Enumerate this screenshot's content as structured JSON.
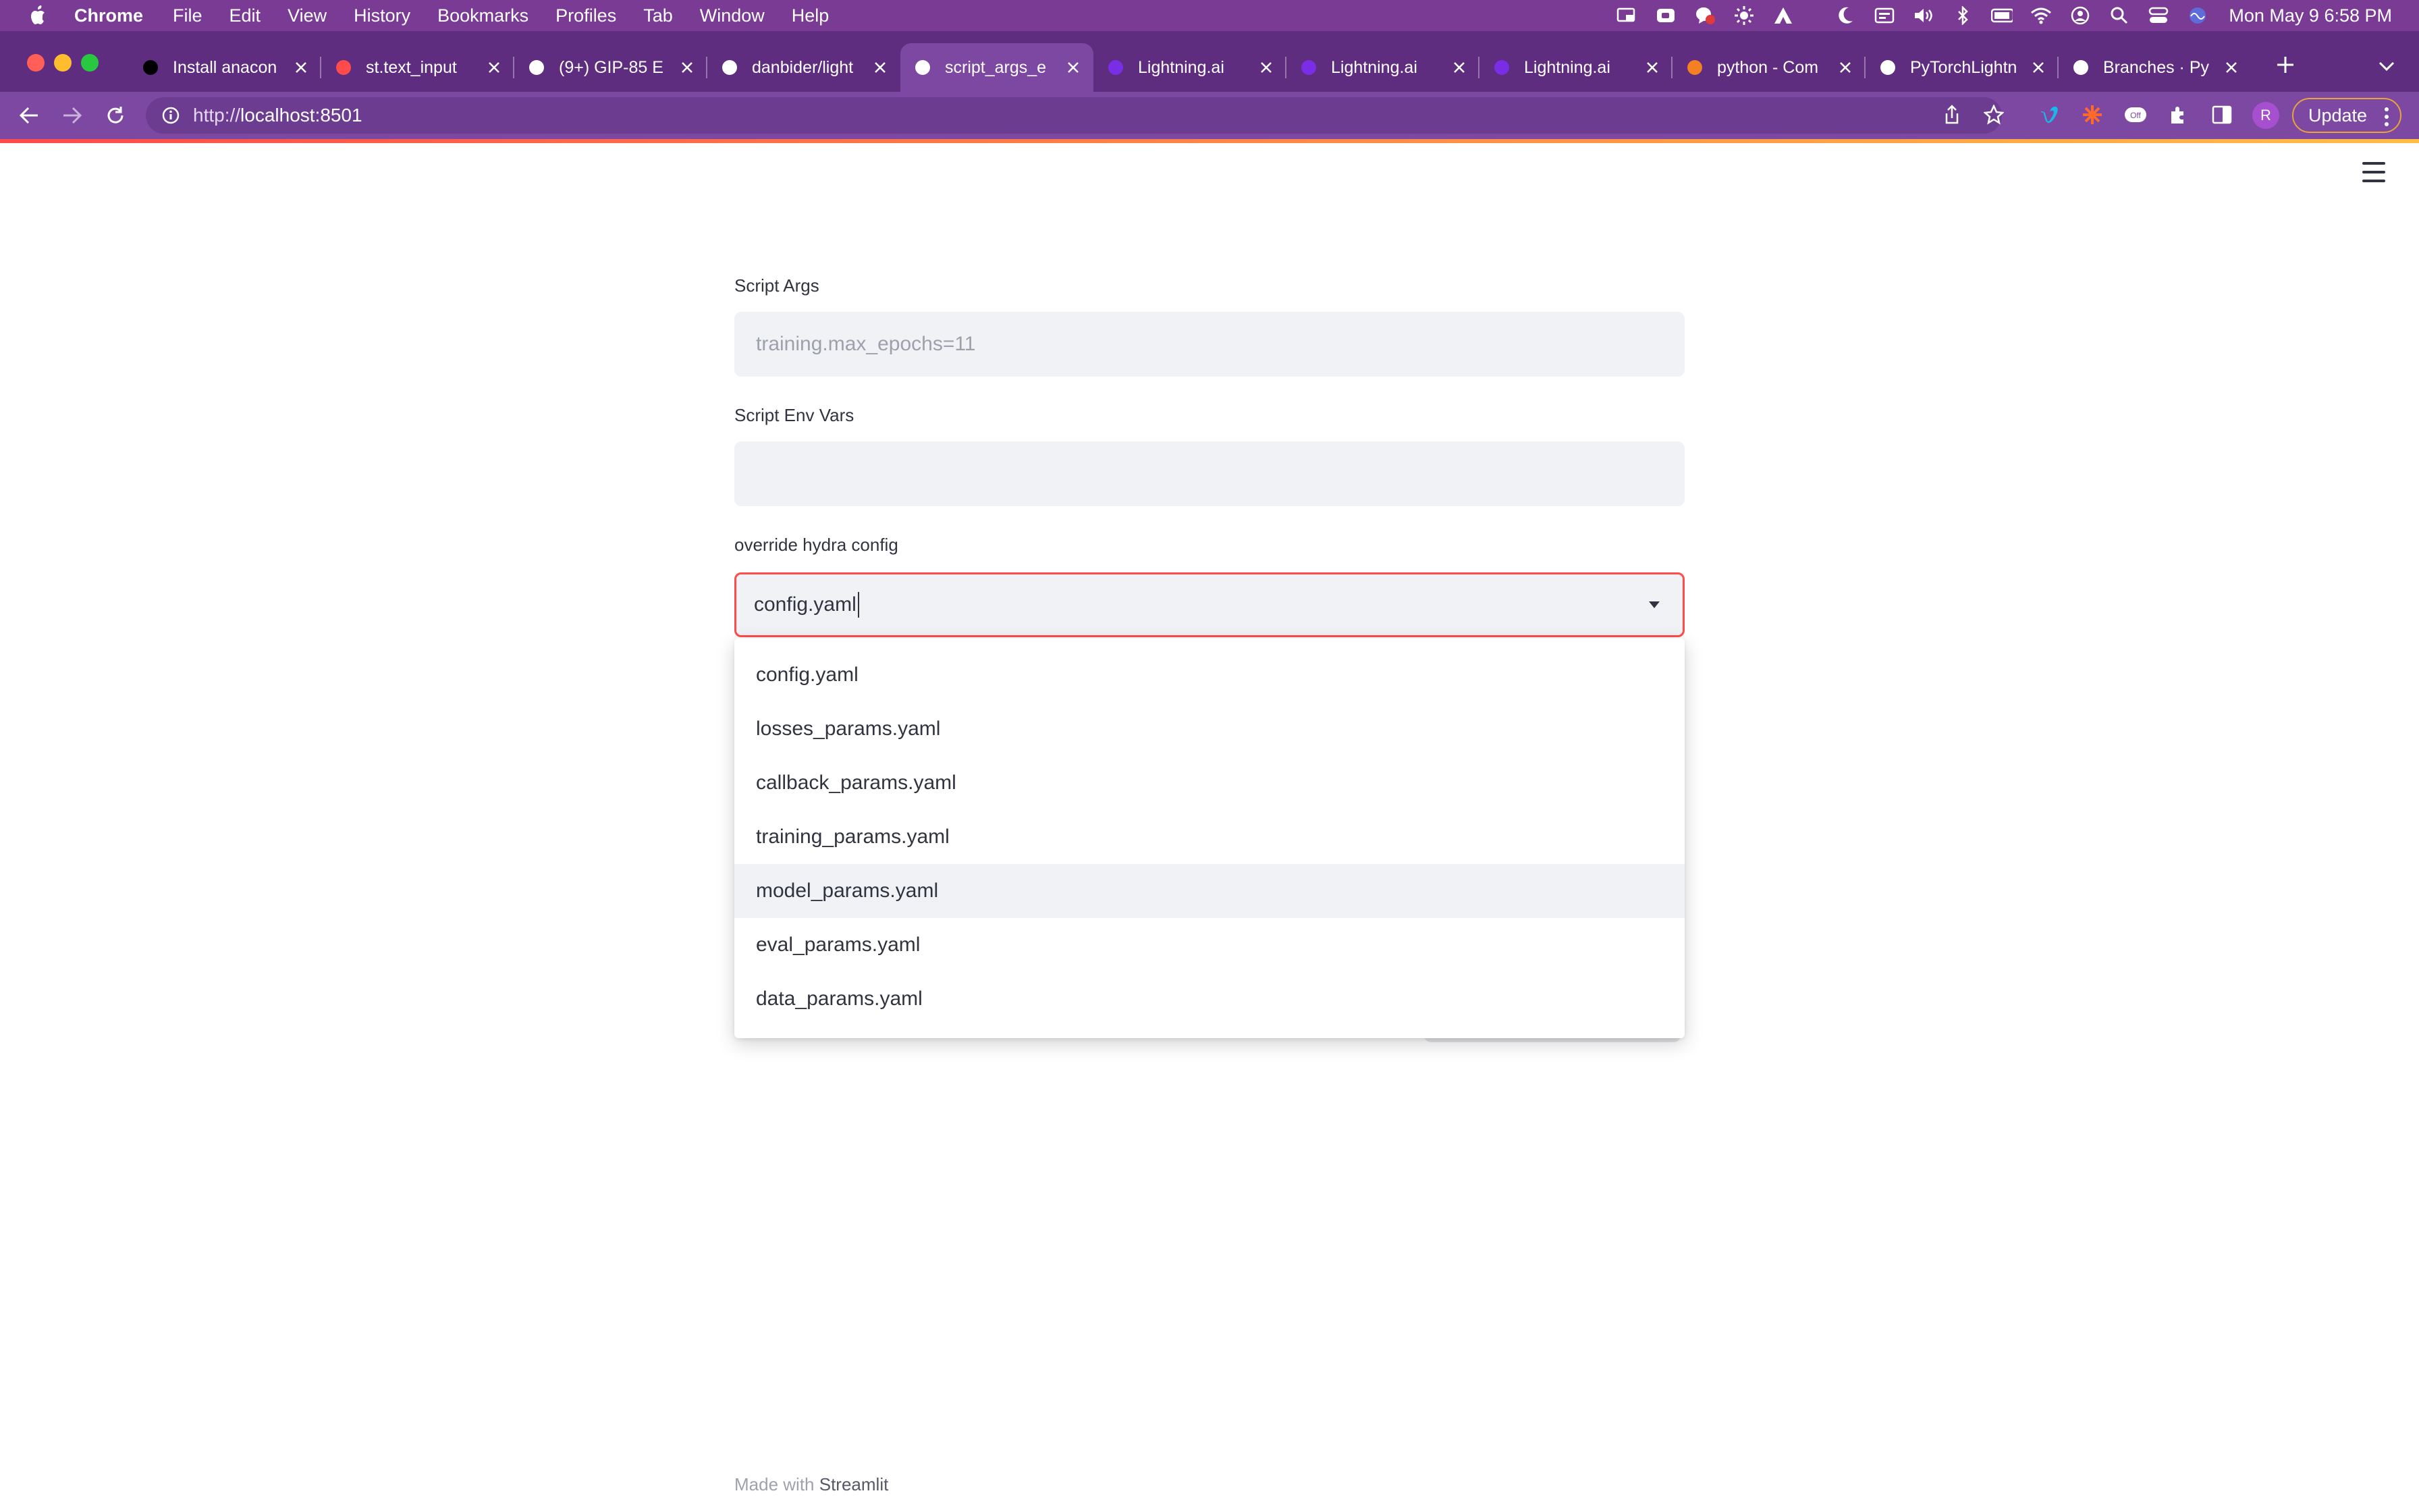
{
  "menubar": {
    "app_name": "Chrome",
    "menus": [
      "File",
      "Edit",
      "View",
      "History",
      "Bookmarks",
      "Profiles",
      "Tab",
      "Window",
      "Help"
    ],
    "clock": "Mon May 9  6:58 PM",
    "status_icons": [
      "screen-share-icon",
      "video-icon",
      "notification-badge-icon",
      "brightness-icon",
      "adobe-icon",
      "moon-icon",
      "calendar-icon",
      "volume-icon",
      "bluetooth-icon",
      "battery-icon",
      "wifi-icon",
      "user-circle-icon",
      "spotlight-search-icon",
      "control-center-icon",
      "siri-icon"
    ]
  },
  "tabs": [
    {
      "title": "Install anacon",
      "icon": "medium-icon",
      "color": "#000000",
      "active": false
    },
    {
      "title": "st.text_input",
      "icon": "streamlit-icon",
      "color": "#ff4b4b",
      "active": false
    },
    {
      "title": "(9+) GIP-85 E",
      "icon": "notion-icon",
      "color": "#ffffff",
      "active": false
    },
    {
      "title": "danbider/light",
      "icon": "github-icon",
      "color": "#ffffff",
      "active": false
    },
    {
      "title": "script_args_e",
      "icon": "streamlit-crown-icon",
      "color": "#ffffff",
      "active": true
    },
    {
      "title": "Lightning.ai",
      "icon": "lightning-icon",
      "color": "#792ee5",
      "active": false
    },
    {
      "title": "Lightning.ai",
      "icon": "lightning-icon",
      "color": "#792ee5",
      "active": false
    },
    {
      "title": "Lightning.ai",
      "icon": "lightning-icon",
      "color": "#792ee5",
      "active": false
    },
    {
      "title": "python - Com",
      "icon": "stackoverflow-icon",
      "color": "#f48024",
      "active": false
    },
    {
      "title": "PyTorchLightn",
      "icon": "github-icon",
      "color": "#ffffff",
      "active": false
    },
    {
      "title": "Branches · Py",
      "icon": "github-icon",
      "color": "#ffffff",
      "active": false
    }
  ],
  "toolbar": {
    "url_prefix": "http://",
    "url_host": "localhost:8501",
    "update_label": "Update",
    "profile_initial": "R"
  },
  "form": {
    "script_args": {
      "label": "Script Args",
      "value": "",
      "placeholder": "training.max_epochs=11"
    },
    "script_env_vars": {
      "label": "Script Env Vars",
      "value": "",
      "placeholder": ""
    },
    "hydra_config": {
      "label": "override hydra config",
      "value": "config.yaml",
      "options": [
        "config.yaml",
        "losses_params.yaml",
        "callback_params.yaml",
        "training_params.yaml",
        "model_params.yaml",
        "eval_params.yaml",
        "data_params.yaml"
      ],
      "hovered_option": "model_params.yaml"
    }
  },
  "footer": {
    "prefix": "Made with ",
    "brand": "Streamlit"
  },
  "colors": {
    "menubar": "#7a3b95",
    "tabstrip": "#5f2d7f",
    "toolbar": "#7c48a2",
    "accent_red": "#ff4b4b",
    "input_bg": "#f0f2f6",
    "text": "#31333f"
  }
}
